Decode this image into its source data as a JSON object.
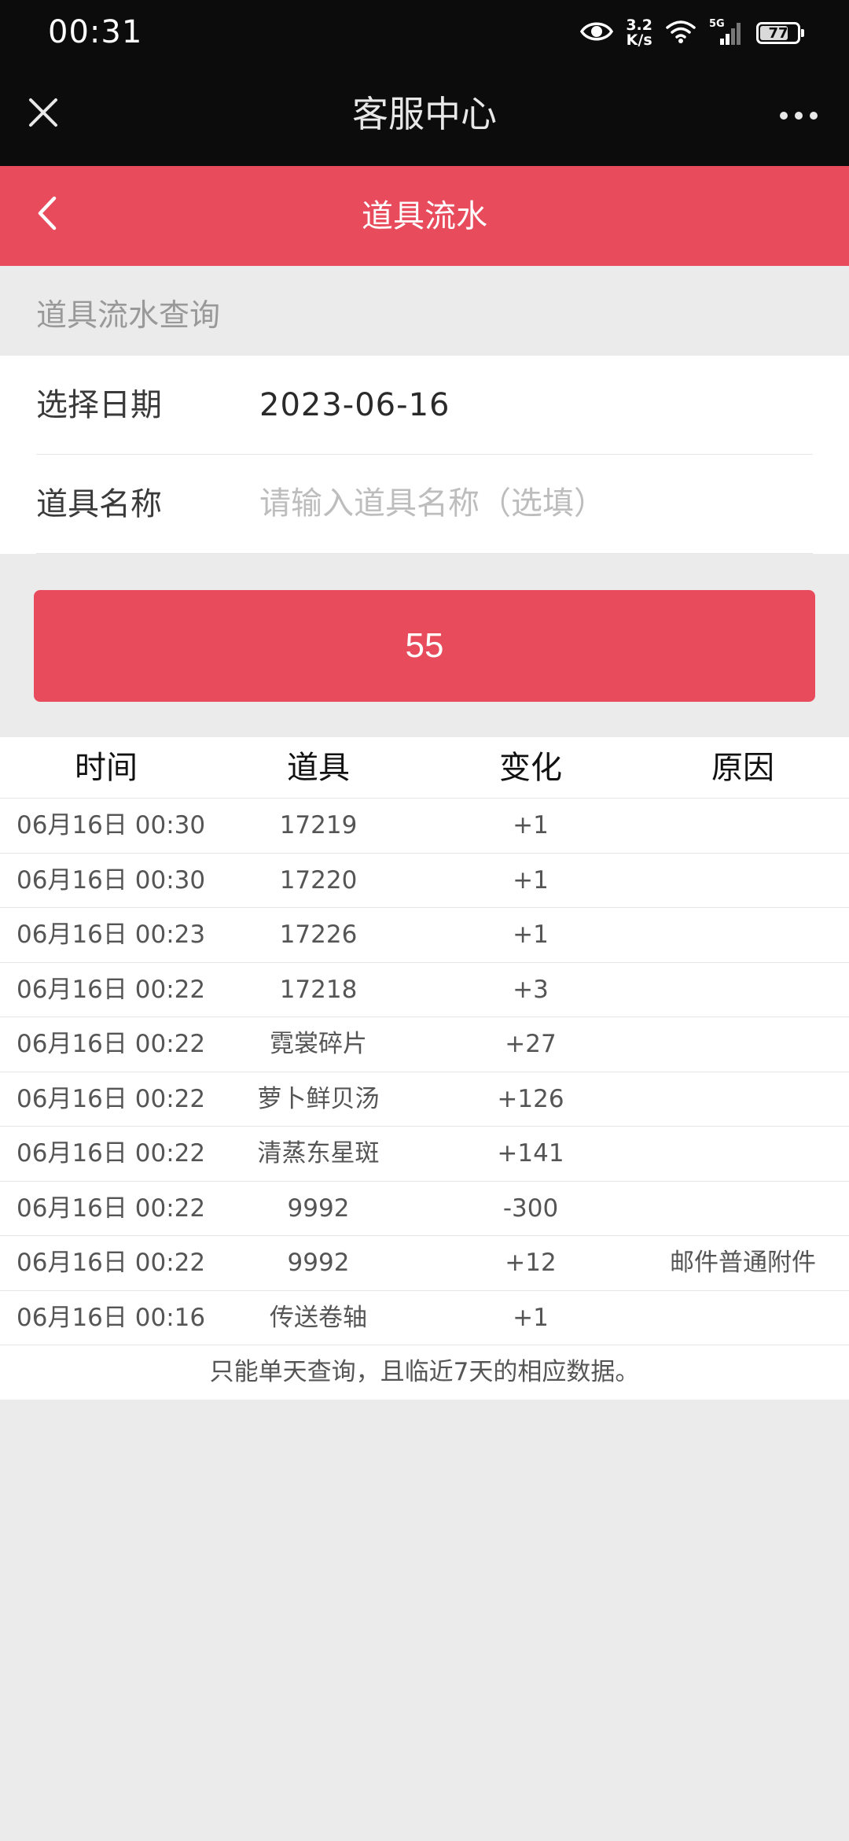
{
  "status_bar": {
    "time": "00:31",
    "net_speed_value": "3.2",
    "net_speed_unit": "K/s",
    "network_type": "5G",
    "battery_level": "77",
    "battery_fraction": 0.77
  },
  "title_bar": {
    "title": "客服中心",
    "close_icon": "close-icon",
    "more_icon": "more-dots-icon"
  },
  "header": {
    "title": "道具流水",
    "back_icon": "chevron-left-icon",
    "color": "#e74b5c"
  },
  "section": {
    "label": "道具流水查询"
  },
  "form": {
    "date_label": "选择日期",
    "date_value": "2023-06-16",
    "item_label": "道具名称",
    "item_value": "",
    "item_placeholder": "请输入道具名称（选填）"
  },
  "query_button": {
    "label": "55"
  },
  "table": {
    "headers": [
      "时间",
      "道具",
      "变化",
      "原因"
    ],
    "rows": [
      [
        "06月16日 00:30",
        "17219",
        "+1",
        ""
      ],
      [
        "06月16日 00:30",
        "17220",
        "+1",
        ""
      ],
      [
        "06月16日 00:23",
        "17226",
        "+1",
        ""
      ],
      [
        "06月16日 00:22",
        "17218",
        "+3",
        ""
      ],
      [
        "06月16日 00:22",
        "霓裳碎片",
        "+27",
        ""
      ],
      [
        "06月16日 00:22",
        "萝卜鲜贝汤",
        "+126",
        ""
      ],
      [
        "06月16日 00:22",
        "清蒸东星斑",
        "+141",
        ""
      ],
      [
        "06月16日 00:22",
        "9992",
        "-300",
        ""
      ],
      [
        "06月16日 00:22",
        "9992",
        "+12",
        "邮件普通附件"
      ],
      [
        "06月16日 00:16",
        "传送卷轴",
        "+1",
        ""
      ]
    ],
    "note": "只能单天查询，且临近7天的相应数据。"
  }
}
